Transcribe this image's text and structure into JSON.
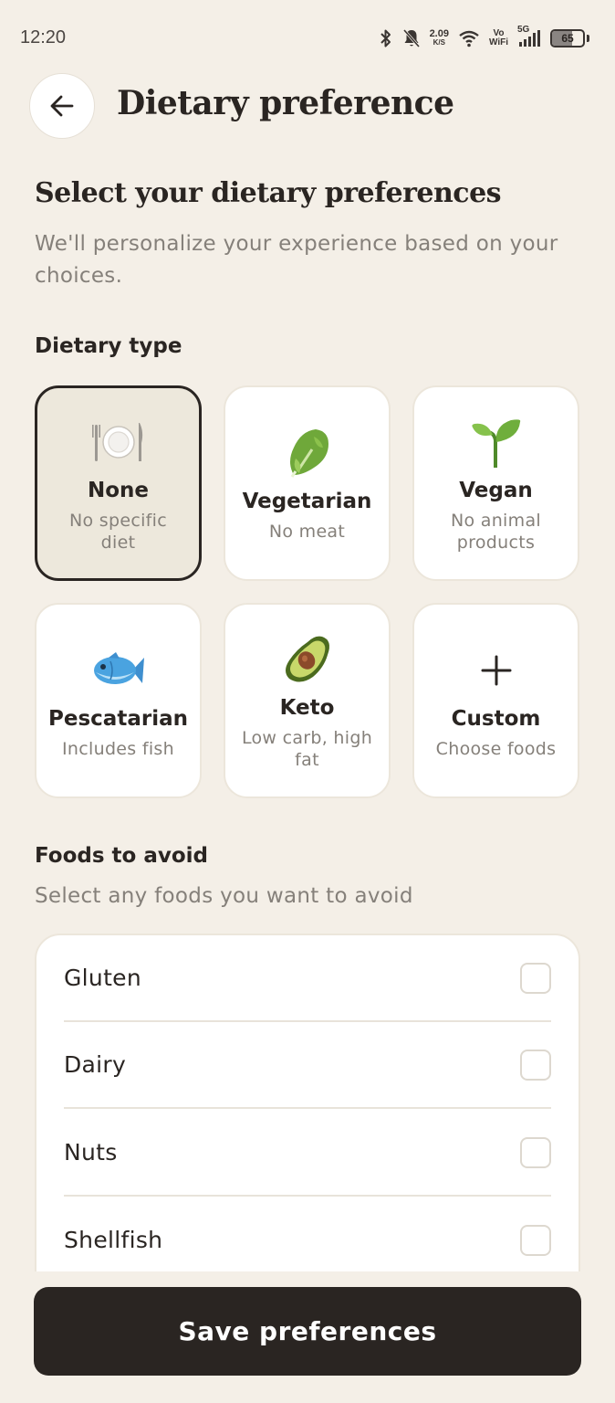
{
  "status_bar": {
    "time": "12:20",
    "net_speed": "2.09",
    "net_unit": "K/S",
    "vo": "Vo",
    "wifi": "WiFi",
    "network": "5G",
    "battery": "65",
    "battery_level": 0.65
  },
  "header": {
    "title": "Dietary preference"
  },
  "intro": {
    "title": "Select your dietary preferences",
    "subtitle": "We'll personalize your experience based on your choices."
  },
  "dietary_type": {
    "label": "Dietary type",
    "options": [
      {
        "name": "None",
        "desc": "No specific diet",
        "icon": "plate-cutlery-icon",
        "selected": true
      },
      {
        "name": "Vegetarian",
        "desc": "No meat",
        "icon": "leafy-green-icon",
        "selected": false
      },
      {
        "name": "Vegan",
        "desc": "No animal products",
        "icon": "seedling-icon",
        "selected": false
      },
      {
        "name": "Pescatarian",
        "desc": "Includes fish",
        "icon": "fish-icon",
        "selected": false
      },
      {
        "name": "Keto",
        "desc": "Low carb, high fat",
        "icon": "avocado-icon",
        "selected": false
      },
      {
        "name": "Custom",
        "desc": "Choose foods",
        "icon": "plus-icon",
        "selected": false
      }
    ]
  },
  "foods_to_avoid": {
    "label": "Foods to avoid",
    "subtitle": "Select any foods you want to avoid",
    "items": [
      {
        "label": "Gluten",
        "checked": false
      },
      {
        "label": "Dairy",
        "checked": false
      },
      {
        "label": "Nuts",
        "checked": false
      },
      {
        "label": "Shellfish",
        "checked": false
      }
    ]
  },
  "save_button": {
    "label": "Save preferences"
  }
}
